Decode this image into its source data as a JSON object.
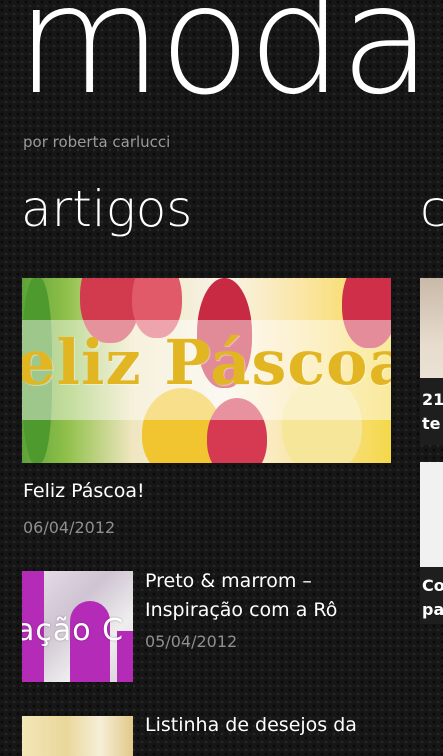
{
  "header": {
    "app_title": "moda",
    "subtitle": "por roberta carlucci"
  },
  "sections": {
    "current_title": "artigos",
    "next_title_peek": "c"
  },
  "featured": {
    "image_text": "eliz Páscoa",
    "title": "Feliz Páscoa!",
    "date": "06/04/2012"
  },
  "articles": [
    {
      "title_line1": "Preto & marrom –",
      "title_line2": "Inspiração com a Rô",
      "date": "05/04/2012",
      "thumb_text": "ação C"
    },
    {
      "title_line1": "Listinha de desejos da"
    }
  ],
  "peek": [
    {
      "line1": "21",
      "line2": "te"
    },
    {
      "line1": "Co",
      "line2": "pa"
    }
  ]
}
